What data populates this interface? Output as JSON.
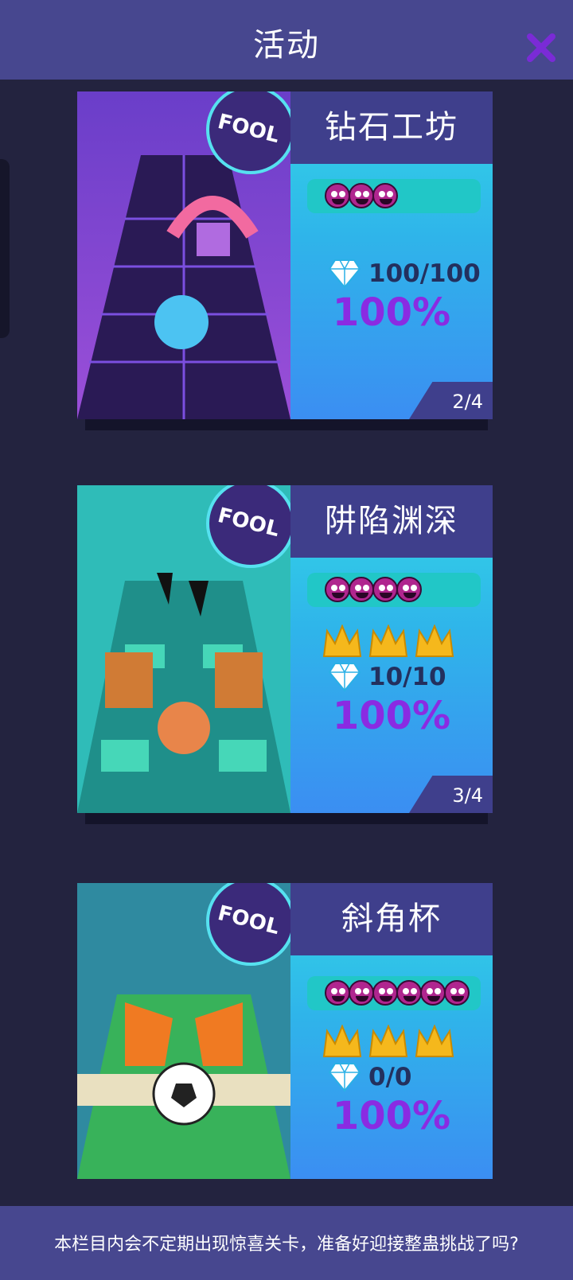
{
  "header": {
    "title": "活动"
  },
  "levels": [
    {
      "name": "钻石工坊",
      "difficulty": 3,
      "crowns": 0,
      "gems": "100/100",
      "percent": "100%",
      "page": "2/4",
      "art": "FOOL"
    },
    {
      "name": "阱陷渊深",
      "difficulty": 4,
      "crowns": 3,
      "gems": "10/10",
      "percent": "100%",
      "page": "3/4",
      "art": "FOOL"
    },
    {
      "name": "斜角杯",
      "difficulty": 6,
      "crowns": 3,
      "gems": "0/0",
      "percent": "100%",
      "page": "",
      "art": "FOOL"
    }
  ],
  "footer": {
    "text": "本栏目内会不定期出现惊喜关卡，准备好迎接整蛊挑战了吗?"
  },
  "colors": {
    "accent": "#47478f",
    "percent": "#8a2be2",
    "panel_top": "#33d6e6",
    "panel_bottom": "#3b8ef2"
  }
}
